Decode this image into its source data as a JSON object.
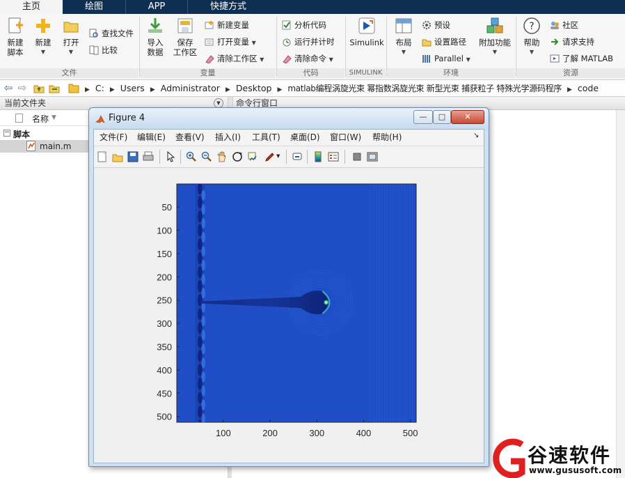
{
  "ribbon_tabs": [
    "主页",
    "绘图",
    "APP",
    "快捷方式"
  ],
  "ribbon": {
    "file": {
      "new_script": "新建\n脚本",
      "new": "新建",
      "open": "打开",
      "find_files": "查找文件",
      "compare": "比较",
      "group": "文件"
    },
    "variable": {
      "import_data": "导入\n数据",
      "save_workspace": "保存\n工作区",
      "new_variable": "新建变量",
      "open_variable": "打开变量",
      "clear_workspace": "清除工作区",
      "group": "变量"
    },
    "code": {
      "analyze_code": "分析代码",
      "run_and_time": "运行并计时",
      "clear_commands": "清除命令",
      "group": "代码"
    },
    "simulink": {
      "label": "Simulink",
      "group": "SIMULINK"
    },
    "environment": {
      "layout": "布局",
      "preferences": "预设",
      "set_path": "设置路径",
      "parallel": "Parallel",
      "addons": "附加功能",
      "group": "环境"
    },
    "resources": {
      "help": "帮助",
      "community": "社区",
      "request_support": "请求支持",
      "learn_matlab": "了解 MATLAB",
      "group": "资源"
    }
  },
  "address": {
    "crumbs": [
      "C:",
      "Users",
      "Administrator",
      "Desktop",
      "matlab编程涡旋光束 幂指数涡旋光束 新型光束 捕获粒子 特殊光学源码程序",
      "code"
    ]
  },
  "current_folder": {
    "title": "当前文件夹",
    "column_name": "名称",
    "group": "脚本",
    "file": "main.m"
  },
  "command_window": {
    "title": "命令行窗口"
  },
  "figure": {
    "title": "Figure 4",
    "menu": [
      "文件(F)",
      "编辑(E)",
      "查看(V)",
      "插入(I)",
      "工具(T)",
      "桌面(D)",
      "窗口(W)",
      "帮助(H)"
    ],
    "window_buttons": {
      "minimize": "—",
      "maximize": "□",
      "close": "✕"
    }
  },
  "chart_data": {
    "type": "heatmap",
    "title": "",
    "xlabel": "",
    "ylabel": "",
    "x_ticks": [
      100,
      200,
      300,
      400,
      500
    ],
    "y_ticks": [
      50,
      100,
      150,
      200,
      250,
      300,
      350,
      400,
      450,
      500
    ],
    "xlim": [
      0.5,
      512.5
    ],
    "ylim": [
      0.5,
      512.5
    ],
    "y_direction": "reversed",
    "colormap": "parula",
    "features": {
      "vertical_fringe_x": [
        40,
        60
      ],
      "horizontal_beam_y": 255,
      "beam_x_range": [
        50,
        325
      ],
      "bright_spot": [
        320,
        255
      ]
    }
  },
  "watermark": {
    "brand": "谷速软件",
    "url": "www.gususoft.com"
  },
  "colors": {
    "ribbon_dark": "#0f2f52",
    "plot_base": "#1f4ec7",
    "plot_dark": "#132a8a",
    "plot_bright": "#f4e32a"
  }
}
